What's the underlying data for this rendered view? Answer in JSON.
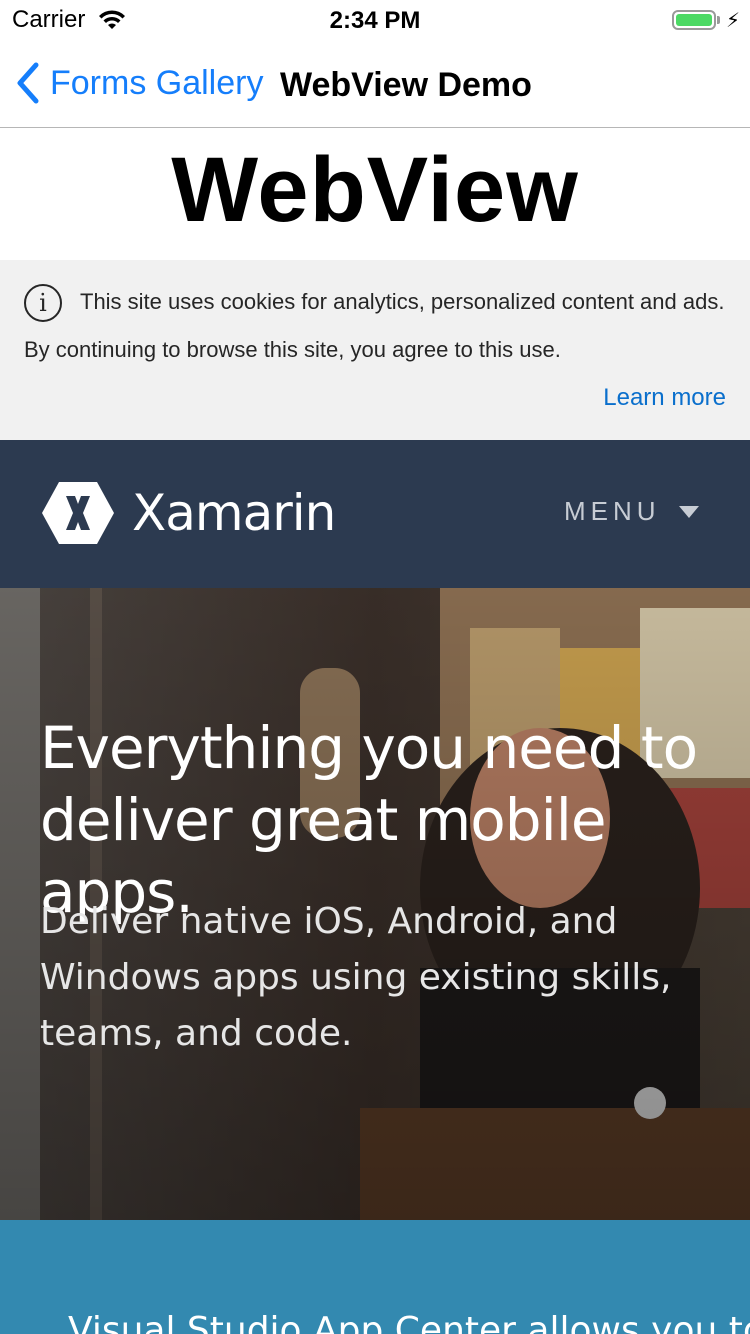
{
  "status_bar": {
    "carrier": "Carrier",
    "time": "2:34 PM",
    "battery_color": "#4cd964"
  },
  "nav": {
    "back_label": "Forms Gallery",
    "title": "WebView Demo",
    "accent": "#157efb"
  },
  "page": {
    "heading": "WebView"
  },
  "cookie_banner": {
    "text": "This site uses cookies for analytics, personalized content and ads. By continuing to browse this site, you agree to this use.",
    "learn_more": "Learn more"
  },
  "site_header": {
    "brand": "Xamarin",
    "menu_label": "MENU",
    "background": "#2c3a50"
  },
  "hero": {
    "title": "Everything you need to deliver great mobile apps.",
    "subtitle": "Deliver native iOS, Android, and Windows apps using existing skills, teams, and code."
  },
  "band": {
    "text": "Visual Studio App Center allows you to",
    "background": "#3389b0"
  }
}
